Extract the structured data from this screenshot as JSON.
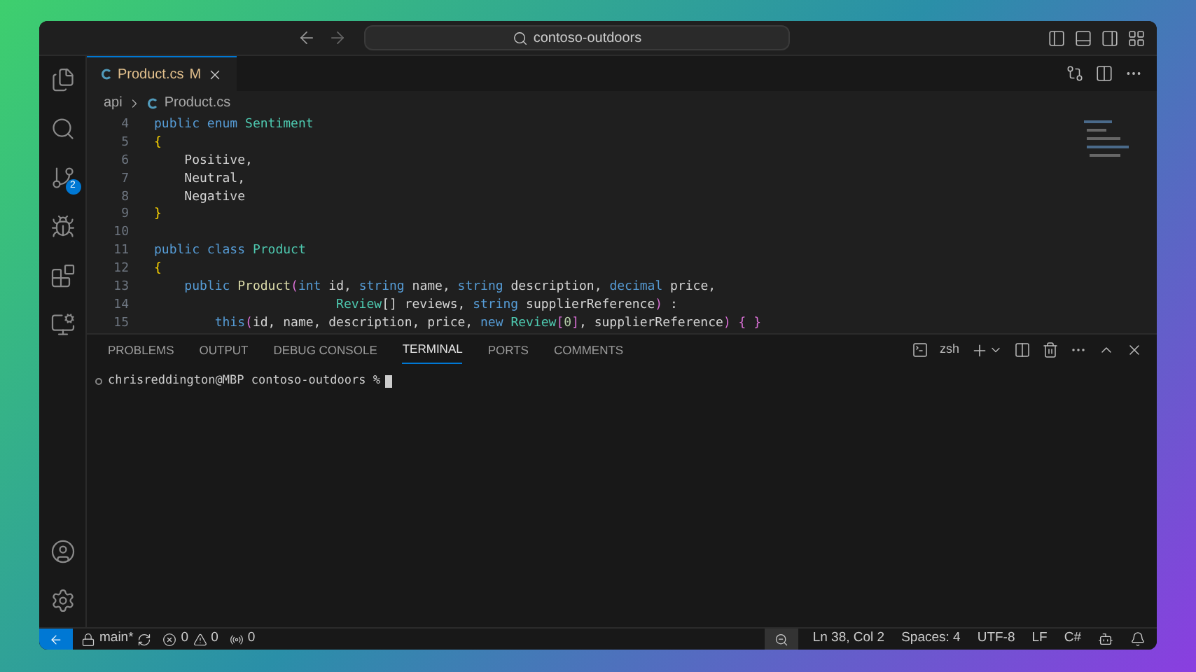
{
  "title_bar": {
    "search_text": "contoso-outdoors"
  },
  "activity_bar": {
    "source_control_badge": "2"
  },
  "tabs": [
    {
      "label": "Product.cs",
      "status": "M",
      "selected": true
    }
  ],
  "breadcrumbs": [
    "api",
    "Product.cs"
  ],
  "code_lines": [
    {
      "number": "4",
      "tokens": [
        {
          "text": "public enum ",
          "kind": "keyword"
        },
        {
          "text": "Sentiment",
          "kind": "type"
        }
      ]
    },
    {
      "number": "5",
      "tokens": [
        {
          "text": "{",
          "kind": "brace"
        }
      ]
    },
    {
      "number": "6",
      "tokens": [
        {
          "text": "    Positive,",
          "kind": "plain"
        }
      ]
    },
    {
      "number": "7",
      "tokens": [
        {
          "text": "    Neutral,",
          "kind": "plain"
        }
      ]
    },
    {
      "number": "8",
      "tokens": [
        {
          "text": "    Negative",
          "kind": "plain"
        }
      ]
    },
    {
      "number": "9",
      "tokens": [
        {
          "text": "}",
          "kind": "brace"
        }
      ]
    },
    {
      "number": "10"
    },
    {
      "number": "11",
      "tokens": [
        {
          "text": "public class ",
          "kind": "keyword"
        },
        {
          "text": "Product",
          "kind": "type"
        }
      ]
    },
    {
      "number": "12",
      "tokens": [
        {
          "text": "{",
          "kind": "brace"
        }
      ]
    },
    {
      "number": "13",
      "tokens": [
        {
          "text": "    public ",
          "kind": "keyword"
        },
        {
          "text": "Product",
          "kind": "func"
        },
        {
          "text": "(",
          "kind": "paren"
        },
        {
          "text": "int ",
          "kind": "keyword"
        },
        {
          "text": "id, ",
          "kind": "plain"
        },
        {
          "text": "string ",
          "kind": "keyword"
        },
        {
          "text": "name, ",
          "kind": "plain"
        },
        {
          "text": "string ",
          "kind": "keyword"
        },
        {
          "text": "description, ",
          "kind": "plain"
        },
        {
          "text": "decimal ",
          "kind": "keyword"
        },
        {
          "text": "price,",
          "kind": "plain"
        }
      ]
    },
    {
      "number": "14",
      "tokens": [
        {
          "text": "                        Review",
          "kind": "type"
        },
        {
          "text": "[] reviews, ",
          "kind": "plain"
        },
        {
          "text": "string ",
          "kind": "keyword"
        },
        {
          "text": "supplierReference",
          "kind": "plain"
        },
        {
          "text": ")",
          "kind": "paren"
        },
        {
          "text": " :",
          "kind": "plain"
        }
      ]
    },
    {
      "number": "15",
      "tokens": [
        {
          "text": "        this",
          "kind": "keyword"
        },
        {
          "text": "(",
          "kind": "paren"
        },
        {
          "text": "id, name, description, price, ",
          "kind": "plain"
        },
        {
          "text": "new ",
          "kind": "keyword"
        },
        {
          "text": "Review",
          "kind": "type"
        },
        {
          "text": "[",
          "kind": "paren"
        },
        {
          "text": "0",
          "kind": "number"
        },
        {
          "text": "]",
          "kind": "paren"
        },
        {
          "text": ", supplierReference",
          "kind": "plain"
        },
        {
          "text": ")",
          "kind": "paren"
        },
        {
          "text": " { }",
          "kind": "paren"
        }
      ]
    }
  ],
  "panel_tabs": [
    {
      "label": "PROBLEMS",
      "selected": false
    },
    {
      "label": "OUTPUT",
      "selected": false
    },
    {
      "label": "DEBUG CONSOLE",
      "selected": false
    },
    {
      "label": "TERMINAL",
      "selected": true
    },
    {
      "label": "PORTS",
      "selected": false
    },
    {
      "label": "COMMENTS",
      "selected": false
    }
  ],
  "terminal": {
    "shell": "zsh",
    "prompt": "chrisreddington@MBP contoso-outdoors %"
  },
  "status_bar": {
    "branch": "main*",
    "errors": "0",
    "warnings": "0",
    "ports": "0",
    "position": "Ln 38, Col 2",
    "indentation": "Spaces: 4",
    "encoding": "UTF-8",
    "eol": "LF",
    "language": "C#"
  }
}
